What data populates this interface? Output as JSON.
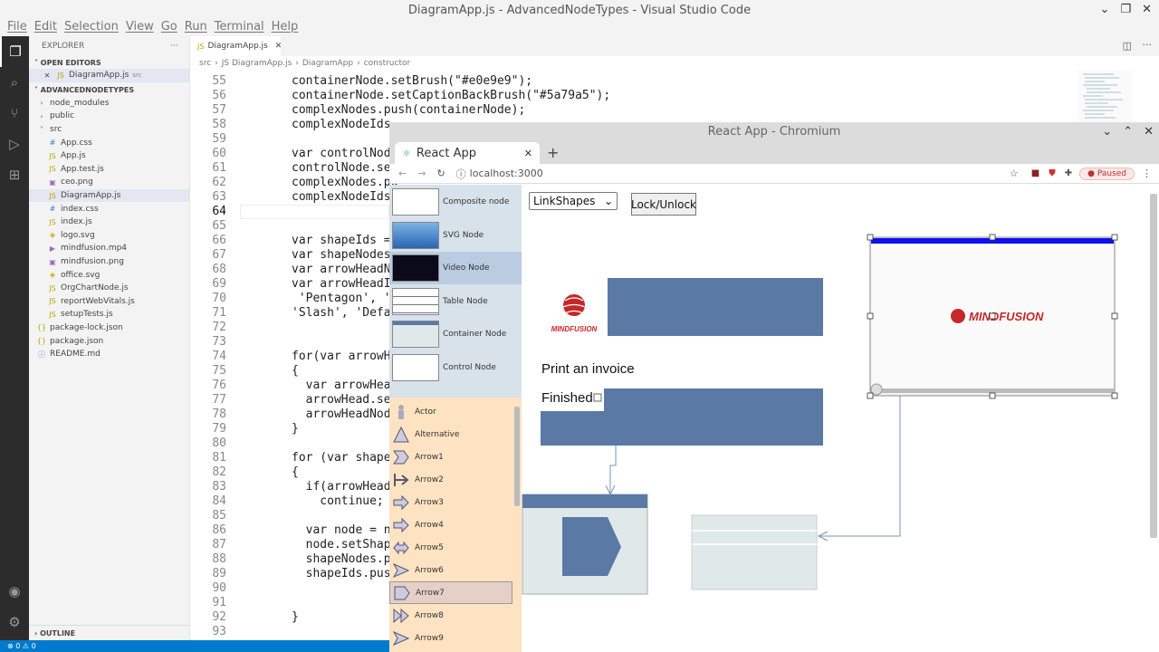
{
  "vscode": {
    "title": "DiagramApp.js - AdvancedNodeTypes - Visual Studio Code",
    "menu": [
      "File",
      "Edit",
      "Selection",
      "View",
      "Go",
      "Run",
      "Terminal",
      "Help"
    ],
    "explorer_label": "EXPLORER",
    "open_editors_label": "OPEN EDITORS",
    "open_editor_file": "DiagramApp.js",
    "open_editor_dir": "src",
    "project_label": "ADVANCEDNODETYPES",
    "tree": [
      {
        "name": "node_modules",
        "kind": "folder",
        "indent": 1
      },
      {
        "name": "public",
        "kind": "folder",
        "indent": 1
      },
      {
        "name": "src",
        "kind": "folder-open",
        "indent": 1
      },
      {
        "name": "App.css",
        "kind": "css",
        "indent": 2
      },
      {
        "name": "App.js",
        "kind": "js",
        "indent": 2
      },
      {
        "name": "App.test.js",
        "kind": "js",
        "indent": 2
      },
      {
        "name": "ceo.png",
        "kind": "img",
        "indent": 2
      },
      {
        "name": "DiagramApp.js",
        "kind": "js",
        "indent": 2,
        "selected": true
      },
      {
        "name": "index.css",
        "kind": "css",
        "indent": 2
      },
      {
        "name": "index.js",
        "kind": "js",
        "indent": 2
      },
      {
        "name": "logo.svg",
        "kind": "svg",
        "indent": 2
      },
      {
        "name": "mindfusion.mp4",
        "kind": "video",
        "indent": 2
      },
      {
        "name": "mindfusion.png",
        "kind": "img",
        "indent": 2
      },
      {
        "name": "office.svg",
        "kind": "svg",
        "indent": 2
      },
      {
        "name": "OrgChartNode.js",
        "kind": "js",
        "indent": 2
      },
      {
        "name": "reportWebVitals.js",
        "kind": "js",
        "indent": 2
      },
      {
        "name": "setupTests.js",
        "kind": "js",
        "indent": 2
      },
      {
        "name": "package-lock.json",
        "kind": "json",
        "indent": 1
      },
      {
        "name": "package.json",
        "kind": "json",
        "indent": 1
      },
      {
        "name": "README.md",
        "kind": "md",
        "indent": 1
      }
    ],
    "outline_label": "OUTLINE",
    "tab_label": "DiagramApp.js",
    "breadcrumb": [
      "src",
      "JS DiagramApp.js",
      "DiagramApp",
      "constructor"
    ],
    "current_line": "64",
    "code_lines": [
      {
        "n": "55",
        "t": "containerNode.setBrush(\"#e0e9e9\");"
      },
      {
        "n": "56",
        "t": "containerNode.setCaptionBackBrush(\"#5a79a5\");"
      },
      {
        "n": "57",
        "t": "complexNodes.push(containerNode);"
      },
      {
        "n": "58",
        "t": "complexNodeIds."
      },
      {
        "n": "59",
        "t": ""
      },
      {
        "n": "60",
        "t": "var controlNode"
      },
      {
        "n": "61",
        "t": "controlNode.set"
      },
      {
        "n": "62",
        "t": "complexNodes.pu"
      },
      {
        "n": "63",
        "t": "complexNodeIds."
      },
      {
        "n": "64",
        "t": ""
      },
      {
        "n": "65",
        "t": ""
      },
      {
        "n": "66",
        "t": "var shapeIds ="
      },
      {
        "n": "67",
        "t": "var shapeNodes"
      },
      {
        "n": "68",
        "t": "var arrowHeadNo"
      },
      {
        "n": "69",
        "t": "var arrowHeadId"
      },
      {
        "n": "70",
        "t": " 'Pentagon', 'R"
      },
      {
        "n": "71",
        "t": "'Slash', 'Defau"
      },
      {
        "n": "72",
        "t": ""
      },
      {
        "n": "73",
        "t": ""
      },
      {
        "n": "74",
        "t": "for(var arrowHe"
      },
      {
        "n": "75",
        "t": "{"
      },
      {
        "n": "76",
        "t": "  var arrowHead"
      },
      {
        "n": "77",
        "t": "  arrowHead.set"
      },
      {
        "n": "78",
        "t": "  arrowHeadNode"
      },
      {
        "n": "79",
        "t": "}"
      },
      {
        "n": "80",
        "t": ""
      },
      {
        "n": "81",
        "t": "for (var shapeI"
      },
      {
        "n": "82",
        "t": "{"
      },
      {
        "n": "83",
        "t": "  if(arrowHeadI"
      },
      {
        "n": "84",
        "t": "    continue;"
      },
      {
        "n": "85",
        "t": ""
      },
      {
        "n": "86",
        "t": "  var node = ne"
      },
      {
        "n": "87",
        "t": "  node.setShape"
      },
      {
        "n": "88",
        "t": "  shapeNodes.pu"
      },
      {
        "n": "89",
        "t": "  shapeIds.push"
      },
      {
        "n": "90",
        "t": ""
      },
      {
        "n": "91",
        "t": ""
      },
      {
        "n": "92",
        "t": "}"
      },
      {
        "n": "93",
        "t": ""
      }
    ],
    "status": "⊗ 0 ⚠ 0"
  },
  "chromium": {
    "window_title": "React App - Chromium",
    "tab_title": "React App",
    "url": "localhost:3000",
    "paused_label": "Paused"
  },
  "app": {
    "select_value": "LinkShapes",
    "lock_button": "Lock/Unlock",
    "palette_nodes": [
      "Composite node",
      "SVG Node",
      "Video Node",
      "Table Node",
      "Container Node",
      "Control Node"
    ],
    "palette_selected_index": 2,
    "shapes": [
      "Actor",
      "Alternative",
      "Arrow1",
      "Arrow2",
      "Arrow3",
      "Arrow4",
      "Arrow5",
      "Arrow6",
      "Arrow7",
      "Arrow8",
      "Arrow9"
    ],
    "shapes_selected_index": 8,
    "node_text": "Print an invoice",
    "checkbox_label": "Finished",
    "logo_text": "MINDFUSION",
    "colors": {
      "node_blue": "#5a79a5",
      "container_fill": "#e0e9e9",
      "palette_blue": "#d7e2ea",
      "palette_orange": "#fde3c2"
    }
  }
}
